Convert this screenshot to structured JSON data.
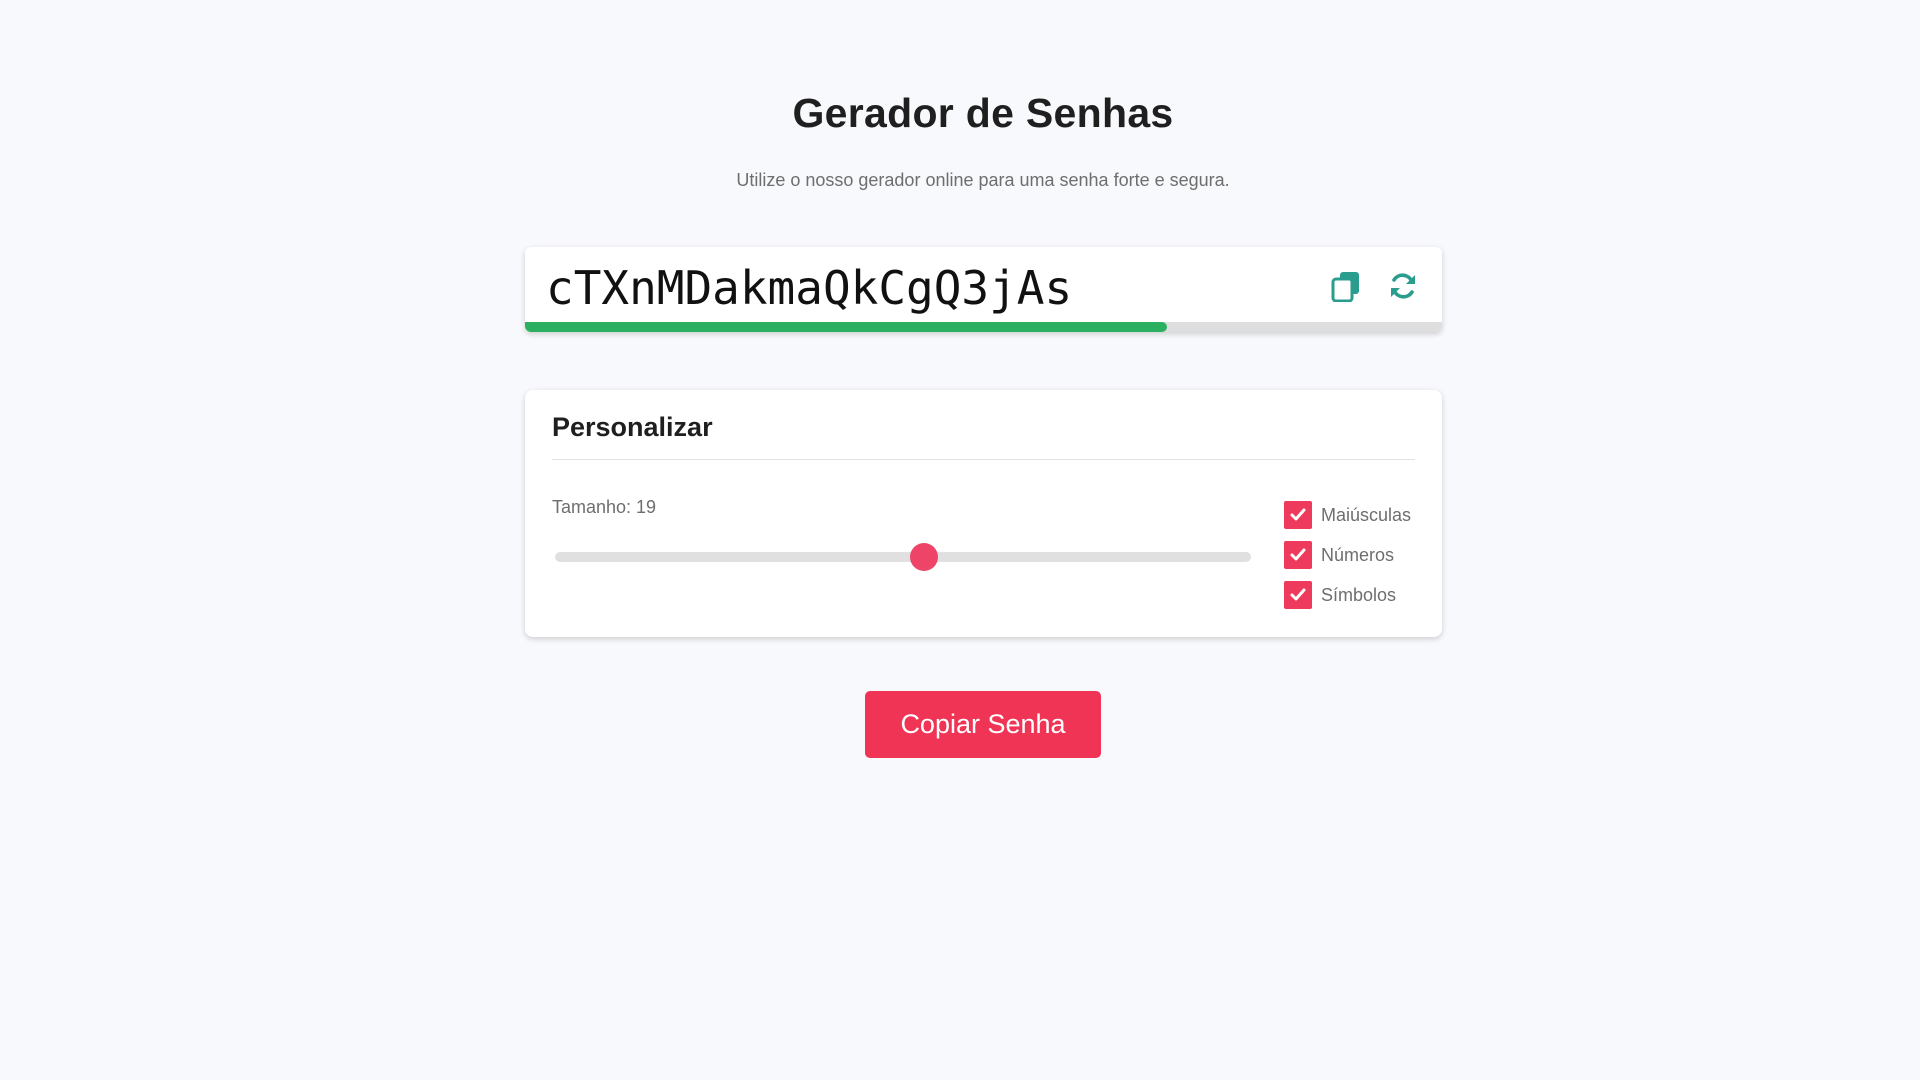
{
  "header": {
    "title": "Gerador de Senhas",
    "subtitle": "Utilize o nosso gerador online para uma senha forte e segura."
  },
  "password": {
    "value": "cTXnMDakmaQkCgQ3jAs",
    "strength_fraction": 0.7,
    "strength_color": "#2bb061",
    "icons": [
      "copy-icon",
      "refresh-icon"
    ],
    "icon_color": "#2a9d8f"
  },
  "customize": {
    "title": "Personalizar",
    "length_label": "Tamanho: 19",
    "length": 19,
    "slider_fraction": 0.53,
    "options": [
      {
        "label": "Maiúsculas",
        "checked": true
      },
      {
        "label": "Números",
        "checked": true
      },
      {
        "label": "Símbolos",
        "checked": true
      }
    ],
    "accent_color": "#ee3a5c"
  },
  "actions": {
    "copy_label": "Copiar Senha"
  }
}
